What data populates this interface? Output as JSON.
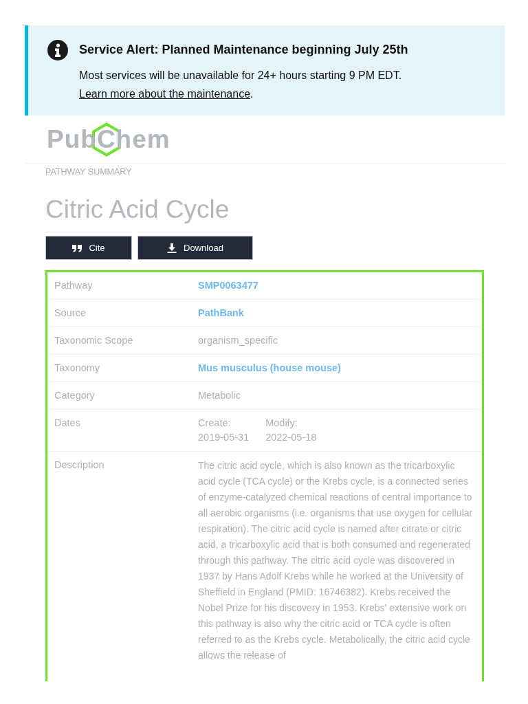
{
  "alert": {
    "title": "Service Alert: Planned Maintenance beginning July 25th",
    "message": "Most services will be unavailable for 24+ hours starting 9 PM EDT.",
    "link": "Learn more about the maintenance",
    "trailing": "."
  },
  "logo": {
    "before": "Pub",
    "ring_letter": "C",
    "after": "hem"
  },
  "page": {
    "eyebrow": "PATHWAY SUMMARY",
    "title": "Citric Acid Cycle"
  },
  "buttons": [
    {
      "kind": "cite",
      "label": "Cite"
    },
    {
      "kind": "download",
      "label": "Download"
    }
  ],
  "summary": {
    "rows": [
      {
        "kind": "link",
        "label": "Pathway",
        "value": "SMP0063477"
      },
      {
        "kind": "link",
        "label": "Source",
        "value": "PathBank"
      },
      {
        "kind": "text",
        "label": "Taxonomic Scope",
        "value": "organism_specific"
      },
      {
        "kind": "link",
        "label": "Taxonomy",
        "value": "Mus musculus (house mouse)"
      },
      {
        "kind": "text",
        "label": "Category",
        "value": "Metabolic"
      },
      {
        "kind": "dates",
        "label": "Dates",
        "dates": [
          {
            "label": "Create:",
            "value": "2019-05-31"
          },
          {
            "label": "Modify:",
            "value": "2022-05-18"
          }
        ]
      },
      {
        "kind": "text",
        "label": "Description",
        "value": "The citric acid cycle, which is also known as the tricarboxylic acid cycle (TCA cycle) or the Krebs cycle, is a connected series of enzyme-catalyzed chemical reactions of central importance to all aerobic organisms (i.e. organisms that use oxygen for cellular respiration). The citric acid cycle is named after citrate or citric acid, a tricarboxylic acid that is both consumed and regenerated through this pathway. The citric acid cycle was discovered in 1937 by Hans Adolf Krebs while he worked at the University of Sheffield in England (PMID: 16746382). Krebs received the Nobel Prize for his discovery in 1953. Krebs' extensive work on this pathway is also why the citric acid or TCA cycle is often referred to as the Krebs cycle. Metabolically, the citric acid cycle allows the release of"
      }
    ]
  }
}
